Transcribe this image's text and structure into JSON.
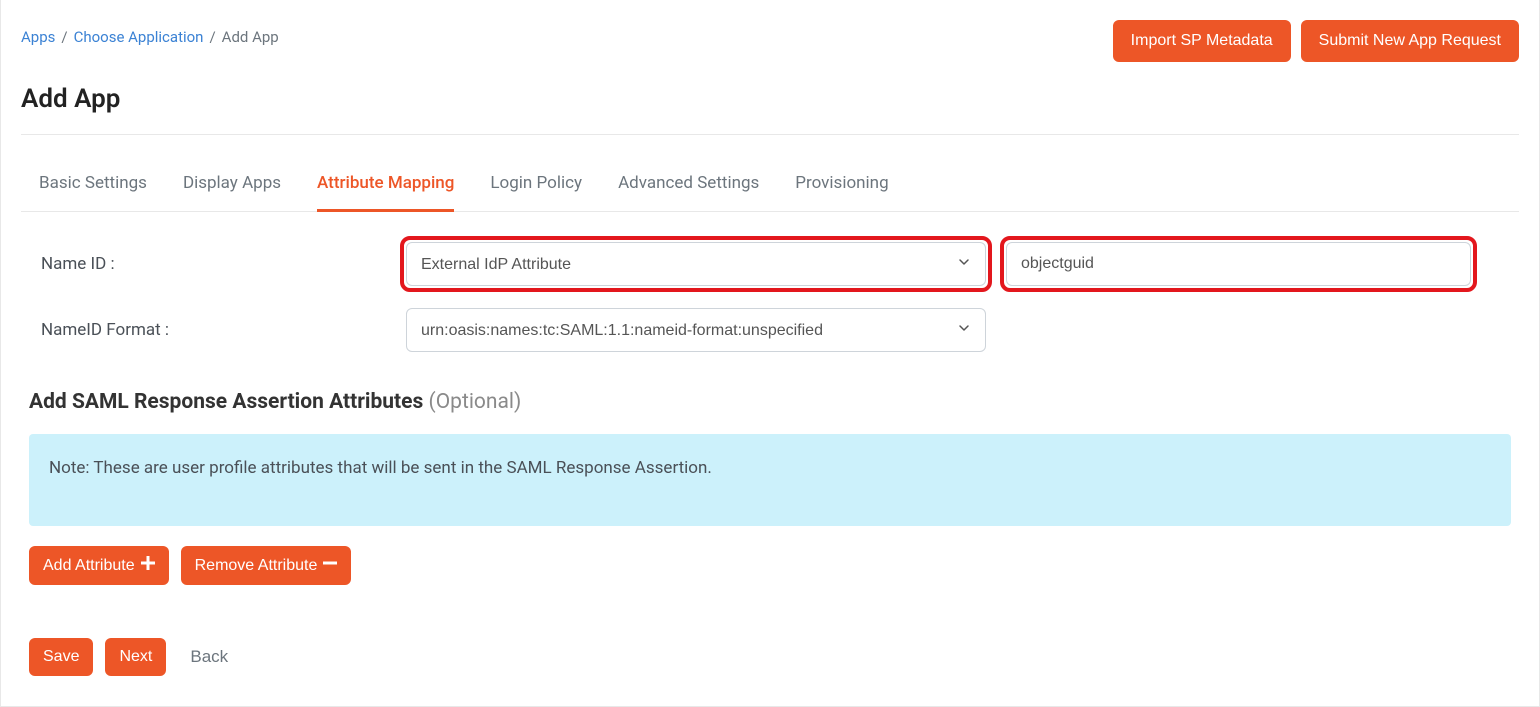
{
  "breadcrumb": {
    "items": [
      {
        "label": "Apps",
        "link": true
      },
      {
        "label": "Choose Application",
        "link": true
      },
      {
        "label": "Add App",
        "link": false
      }
    ]
  },
  "topButtons": {
    "importMetadata": "Import SP Metadata",
    "submitRequest": "Submit New App Request"
  },
  "pageTitle": "Add App",
  "tabs": [
    {
      "label": "Basic Settings",
      "active": false
    },
    {
      "label": "Display Apps",
      "active": false
    },
    {
      "label": "Attribute Mapping",
      "active": true
    },
    {
      "label": "Login Policy",
      "active": false
    },
    {
      "label": "Advanced Settings",
      "active": false
    },
    {
      "label": "Provisioning",
      "active": false
    }
  ],
  "form": {
    "nameIdLabel": "Name ID :",
    "nameIdSelectValue": "External IdP Attribute",
    "nameIdTextValue": "objectguid",
    "nameIdFormatLabel": "NameID Format :",
    "nameIdFormatValue": "urn:oasis:names:tc:SAML:1.1:nameid-format:unspecified"
  },
  "section": {
    "title": "Add SAML Response Assertion Attributes",
    "optional": "(Optional)",
    "note": "Note: These are user profile attributes that will be sent in the SAML Response Assertion."
  },
  "actions": {
    "addAttribute": "Add Attribute",
    "removeAttribute": "Remove Attribute",
    "save": "Save",
    "next": "Next",
    "back": "Back"
  }
}
